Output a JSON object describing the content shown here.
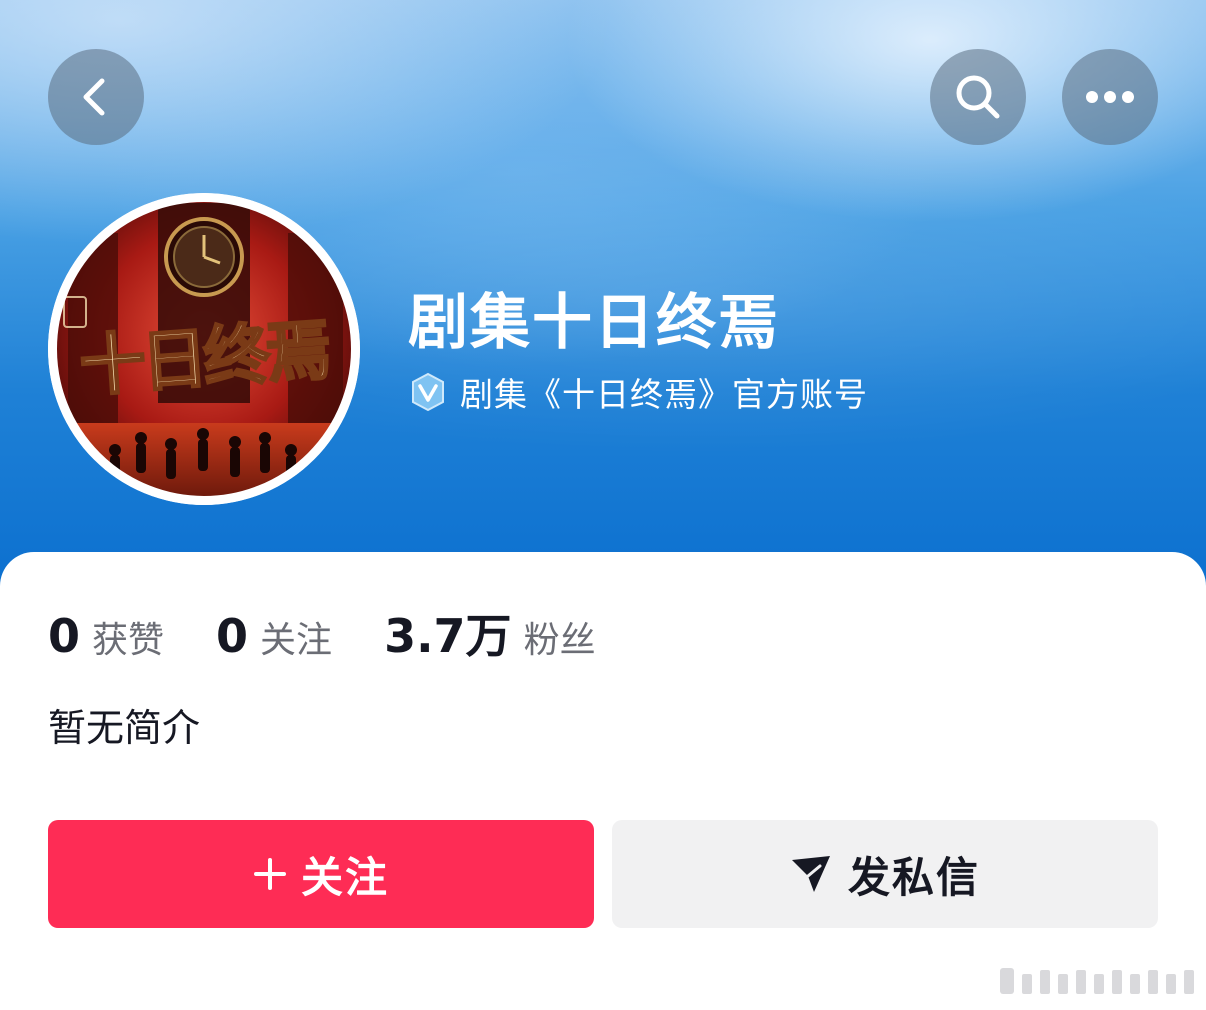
{
  "header": {
    "back_icon": "chevron-left-icon",
    "search_icon": "search-icon",
    "more_icon": "ellipsis-icon"
  },
  "profile": {
    "name": "剧集十日终焉",
    "verification": "剧集《十日终焉》官方账号",
    "verified_icon": "verified-v-icon",
    "avatar_text": "十日终焉"
  },
  "stats": [
    {
      "value": "0",
      "label": "获赞"
    },
    {
      "value": "0",
      "label": "关注"
    },
    {
      "value": "3.7万",
      "label": "粉丝"
    }
  ],
  "bio": "暂无简介",
  "actions": {
    "follow_label": "关注",
    "message_label": "发私信"
  },
  "colors": {
    "follow_button": "#fe2c55",
    "message_button": "#f1f1f2",
    "banner_blue": "#1f81d6"
  }
}
